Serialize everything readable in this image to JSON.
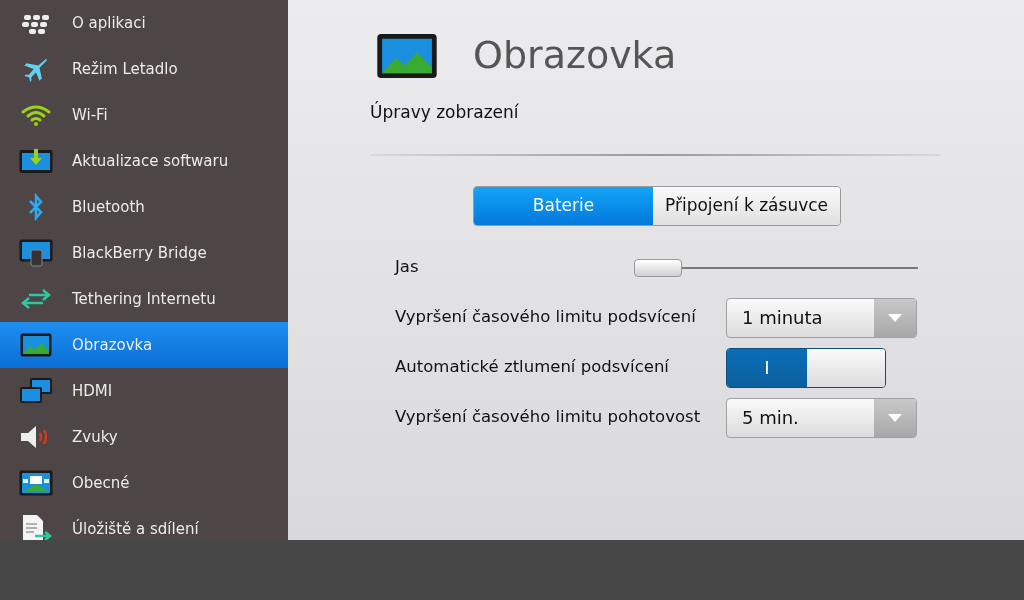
{
  "sidebar": {
    "items": [
      {
        "label": "O aplikaci",
        "selected": false
      },
      {
        "label": "Režim Letadlo",
        "selected": false
      },
      {
        "label": "Wi-Fi",
        "selected": false
      },
      {
        "label": "Aktualizace softwaru",
        "selected": false
      },
      {
        "label": "Bluetooth",
        "selected": false
      },
      {
        "label": "BlackBerry Bridge",
        "selected": false
      },
      {
        "label": "Tethering Internetu",
        "selected": false
      },
      {
        "label": "Obrazovka",
        "selected": true
      },
      {
        "label": "HDMI",
        "selected": false
      },
      {
        "label": "Zvuky",
        "selected": false
      },
      {
        "label": "Obecné",
        "selected": false
      },
      {
        "label": "Úložiště a sdílení",
        "selected": false
      }
    ]
  },
  "page": {
    "title": "Obrazovka",
    "subtitle": "Úpravy zobrazení",
    "tabs": [
      {
        "label": "Baterie",
        "selected": true
      },
      {
        "label": "Připojení k zásuvce",
        "selected": false
      }
    ],
    "settings": [
      {
        "kind": "slider",
        "label": "Jas",
        "level": 0
      },
      {
        "kind": "dropdown",
        "label": "Vypršení časového limitu podsvícení",
        "value": "1 minuta"
      },
      {
        "kind": "toggle",
        "label": "Automatické ztlumení podsvícení",
        "on": true,
        "on_label": "I"
      },
      {
        "kind": "dropdown",
        "label": "Vypršení časového limitu pohotovost",
        "value": "5 min."
      }
    ]
  }
}
